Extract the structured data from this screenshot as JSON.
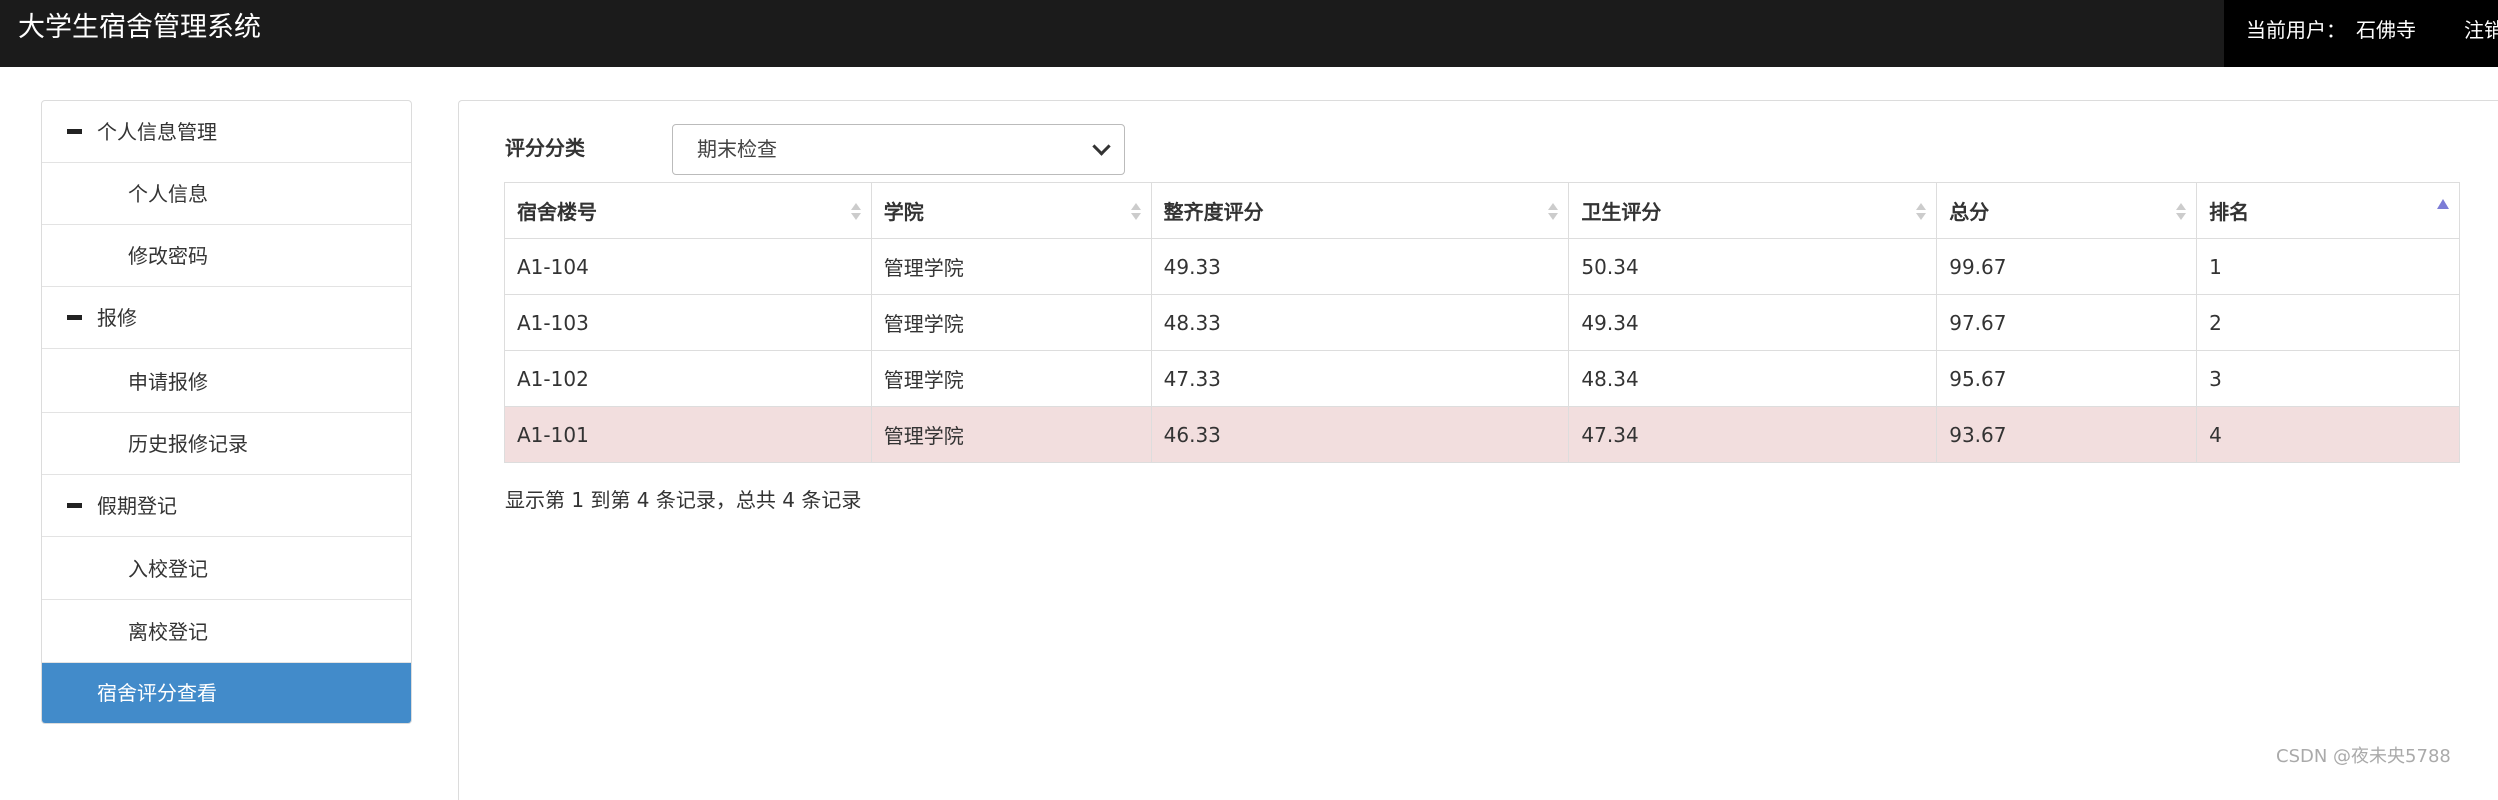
{
  "header": {
    "title": "大学生宿舍管理系统",
    "user_label": "当前用户：",
    "user_name": "石佛寺",
    "logout_label": "注销"
  },
  "sidebar": {
    "items": [
      {
        "label": "个人信息管理",
        "type": "group"
      },
      {
        "label": "个人信息",
        "type": "sub"
      },
      {
        "label": "修改密码",
        "type": "sub"
      },
      {
        "label": "报修",
        "type": "group"
      },
      {
        "label": "申请报修",
        "type": "sub"
      },
      {
        "label": "历史报修记录",
        "type": "sub"
      },
      {
        "label": "假期登记",
        "type": "group"
      },
      {
        "label": "入校登记",
        "type": "sub"
      },
      {
        "label": "离校登记",
        "type": "sub"
      },
      {
        "label": "宿舍评分查看",
        "type": "active"
      }
    ]
  },
  "filter": {
    "label": "评分分类",
    "selected": "期末检查"
  },
  "table": {
    "columns": [
      "宿舍楼号",
      "学院",
      "整齐度评分",
      "卫生评分",
      "总分",
      "排名"
    ],
    "rows": [
      [
        "A1-104",
        "管理学院",
        "49.33",
        "50.34",
        "99.67",
        "1"
      ],
      [
        "A1-103",
        "管理学院",
        "48.33",
        "49.34",
        "97.67",
        "2"
      ],
      [
        "A1-102",
        "管理学院",
        "47.33",
        "48.34",
        "95.67",
        "3"
      ],
      [
        "A1-101",
        "管理学院",
        "46.33",
        "47.34",
        "93.67",
        "4"
      ]
    ],
    "sorted_column": "排名",
    "sort_direction": "ascending"
  },
  "pagination": {
    "info": "显示第 1 到第 4 条记录，总共 4 条记录"
  },
  "watermark": "CSDN @夜未央5788",
  "colors": {
    "topbar": "#1b1b1b",
    "active_item": "#428bca",
    "highlight_row": "#f2dede"
  }
}
